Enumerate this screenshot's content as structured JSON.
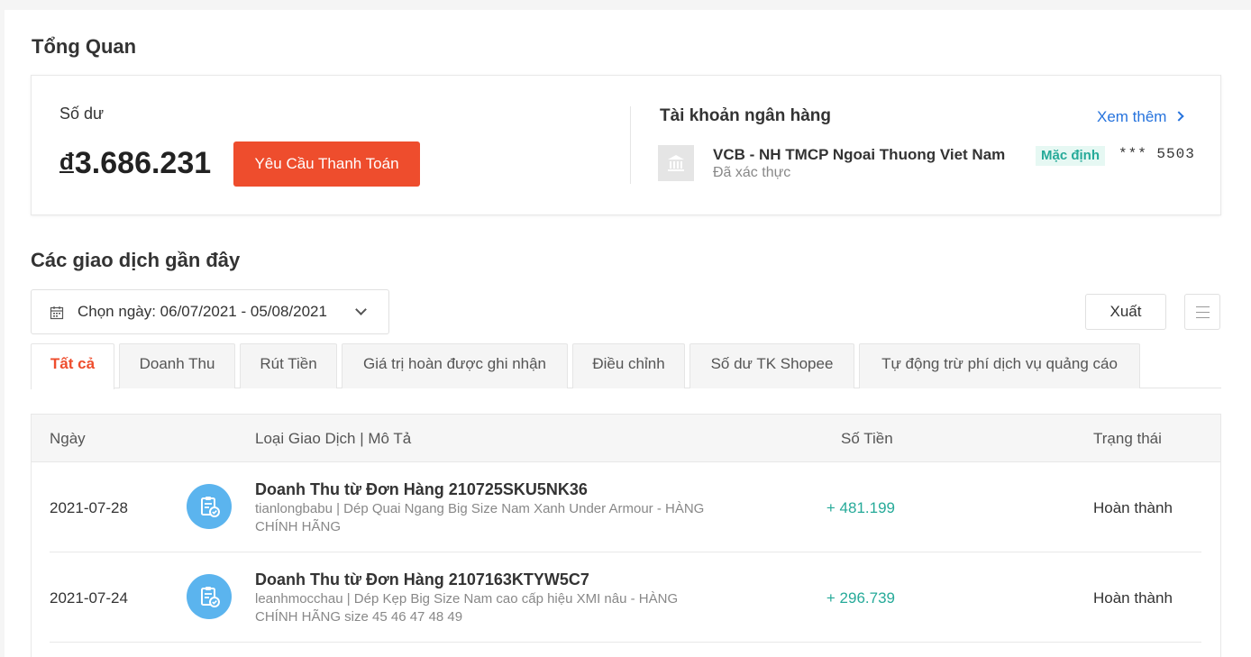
{
  "overview": {
    "title": "Tổng Quan"
  },
  "balance": {
    "label": "Số dư",
    "currency_symbol": "đ",
    "amount": "3.686.231",
    "pay_button": "Yêu Cầu Thanh Toán"
  },
  "bank": {
    "title": "Tài khoản ngân hàng",
    "see_more": "Xem thêm",
    "name": "VCB - NH TMCP Ngoai Thuong Viet Nam",
    "verified": "Đã xác thực",
    "default_badge": "Mặc định",
    "account_number": "*** 5503",
    "icon": "bank-icon"
  },
  "transactions": {
    "title": "Các giao dịch gần đây",
    "date_filter": "Chọn ngày: 06/07/2021 - 05/08/2021",
    "export_label": "Xuất",
    "tabs": [
      {
        "label": "Tất cả",
        "active": true
      },
      {
        "label": "Doanh Thu"
      },
      {
        "label": "Rút Tiền"
      },
      {
        "label": "Giá trị hoàn được ghi nhận"
      },
      {
        "label": "Điều chỉnh"
      },
      {
        "label": "Số dư TK Shopee"
      },
      {
        "label": "Tự động trừ phí dịch vụ quảng cáo"
      }
    ],
    "columns": {
      "date": "Ngày",
      "type": "Loại Giao Dịch | Mô Tả",
      "amount": "Số Tiền",
      "status": "Trạng thái"
    },
    "rows": [
      {
        "date": "2021-07-28",
        "title": "Doanh Thu từ Đơn Hàng 210725SKU5NK36",
        "description": "tianlongbabu | Dép Quai Ngang Big Size Nam Xanh Under Armour - HÀNG CHÍNH HÃNG",
        "amount": "+ 481.199",
        "status": "Hoàn thành"
      },
      {
        "date": "2021-07-24",
        "title": "Doanh Thu từ Đơn Hàng 2107163KTYW5C7",
        "description": "leanhmocchau | Dép Kẹp Big Size Nam cao cấp hiệu XMI nâu - HÀNG CHÍNH HÃNG size 45 46 47 48 49",
        "amount": "+ 296.739",
        "status": "Hoàn thành"
      }
    ]
  },
  "colors": {
    "accent": "#ee4d2d",
    "positive": "#26aa99",
    "link": "#2673dd",
    "icon_bg": "#5bb4ee"
  }
}
